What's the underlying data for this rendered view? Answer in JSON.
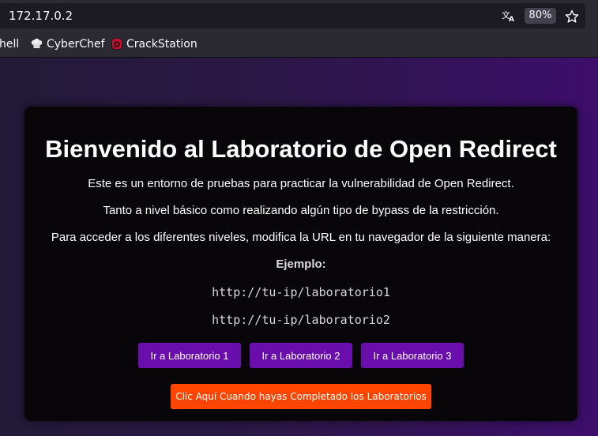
{
  "browser": {
    "url": "172.17.0.2",
    "zoom": "80%",
    "bookmarks": [
      {
        "label": "hell"
      },
      {
        "label": "CyberChef"
      },
      {
        "label": "CrackStation",
        "icon_letter": "D"
      }
    ]
  },
  "page": {
    "title": "Bienvenido al Laboratorio de Open Redirect",
    "paragraphs": [
      "Este es un entorno de pruebas para practicar la vulnerabilidad de Open Redirect.",
      "Tanto a nivel básico como realizando algún tipo de bypass de la restricción.",
      "Para acceder a los diferentes niveles, modifica la URL en tu navegador de la siguiente manera:"
    ],
    "example_label": "Ejemplo:",
    "examples": [
      "http://tu-ip/laboratorio1",
      "http://tu-ip/laboratorio2"
    ],
    "lab_buttons": [
      "Ir a Laboratorio 1",
      "Ir a Laboratorio 2",
      "Ir a Laboratorio 3"
    ],
    "complete_button": "Clic Aquí Cuando hayas Completado los Laboratorios"
  },
  "colors": {
    "lab_button": "#6a0dad",
    "complete_button": "#ff4500",
    "card_bg": "#080608",
    "page_gradient_end": "#3d0e6b"
  }
}
